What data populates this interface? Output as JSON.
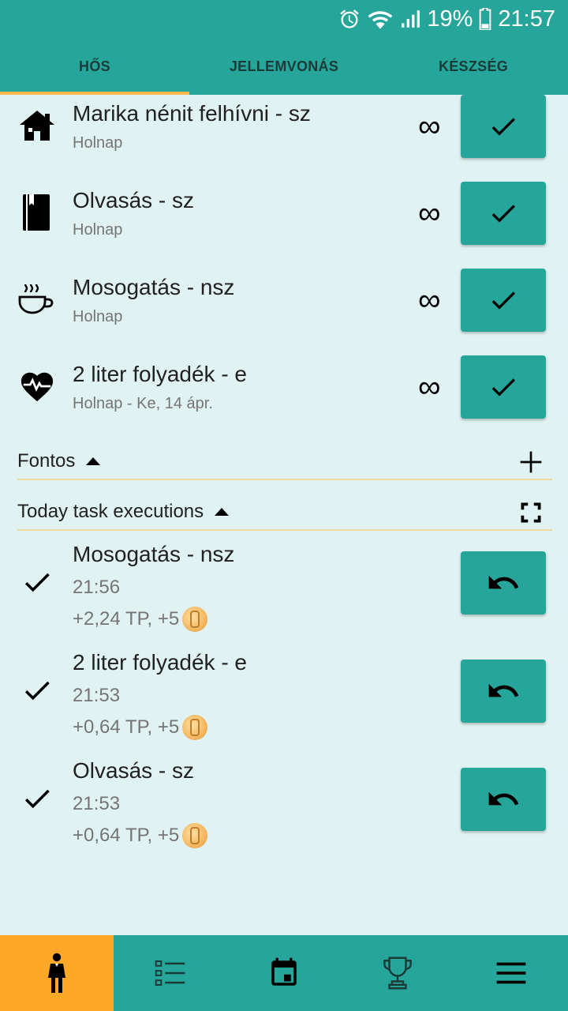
{
  "status_bar": {
    "battery": "19%",
    "time": "21:57",
    "icons": [
      "alarm-icon",
      "wifi-icon",
      "signal-icon",
      "battery-icon"
    ]
  },
  "tabs": [
    {
      "label": "HŐS",
      "active": true
    },
    {
      "label": "JELLEMVONÁS",
      "active": false
    },
    {
      "label": "KÉSZSÉG",
      "active": false
    }
  ],
  "tasks": [
    {
      "title": "Marika nénit felhívni - sz",
      "subtitle": "Holnap",
      "icon": "house-icon",
      "repeat": "∞"
    },
    {
      "title": "Olvasás - sz",
      "subtitle": "Holnap",
      "icon": "book-icon",
      "repeat": "∞"
    },
    {
      "title": "Mosogatás - nsz",
      "subtitle": "Holnap",
      "icon": "cup-icon",
      "repeat": "∞"
    },
    {
      "title": "2 liter folyadék - e",
      "subtitle": "Holnap - Ke, 14 ápr.",
      "icon": "heartbeat-icon",
      "repeat": "∞"
    }
  ],
  "sections": {
    "important": {
      "label": "Fontos",
      "action_icon": "plus-icon"
    },
    "executions": {
      "label": "Today task executions",
      "action_icon": "fullscreen-icon"
    }
  },
  "executions": [
    {
      "title": "Mosogatás - nsz",
      "time": "21:56",
      "reward": "+2,24 TP, +5"
    },
    {
      "title": "2 liter folyadék - e",
      "time": "21:53",
      "reward": "+0,64 TP, +5"
    },
    {
      "title": "Olvasás - sz",
      "time": "21:53",
      "reward": "+0,64 TP, +5"
    }
  ],
  "bottom_nav": [
    {
      "icon": "hero-icon",
      "active": true
    },
    {
      "icon": "list-icon",
      "active": false
    },
    {
      "icon": "calendar-icon",
      "active": false
    },
    {
      "icon": "trophy-icon",
      "active": false
    },
    {
      "icon": "menu-icon",
      "active": false
    }
  ],
  "colors": {
    "primary": "#26a69a",
    "accent": "#ffa726",
    "background": "#e0f2f1",
    "divider": "#f0d79a"
  }
}
